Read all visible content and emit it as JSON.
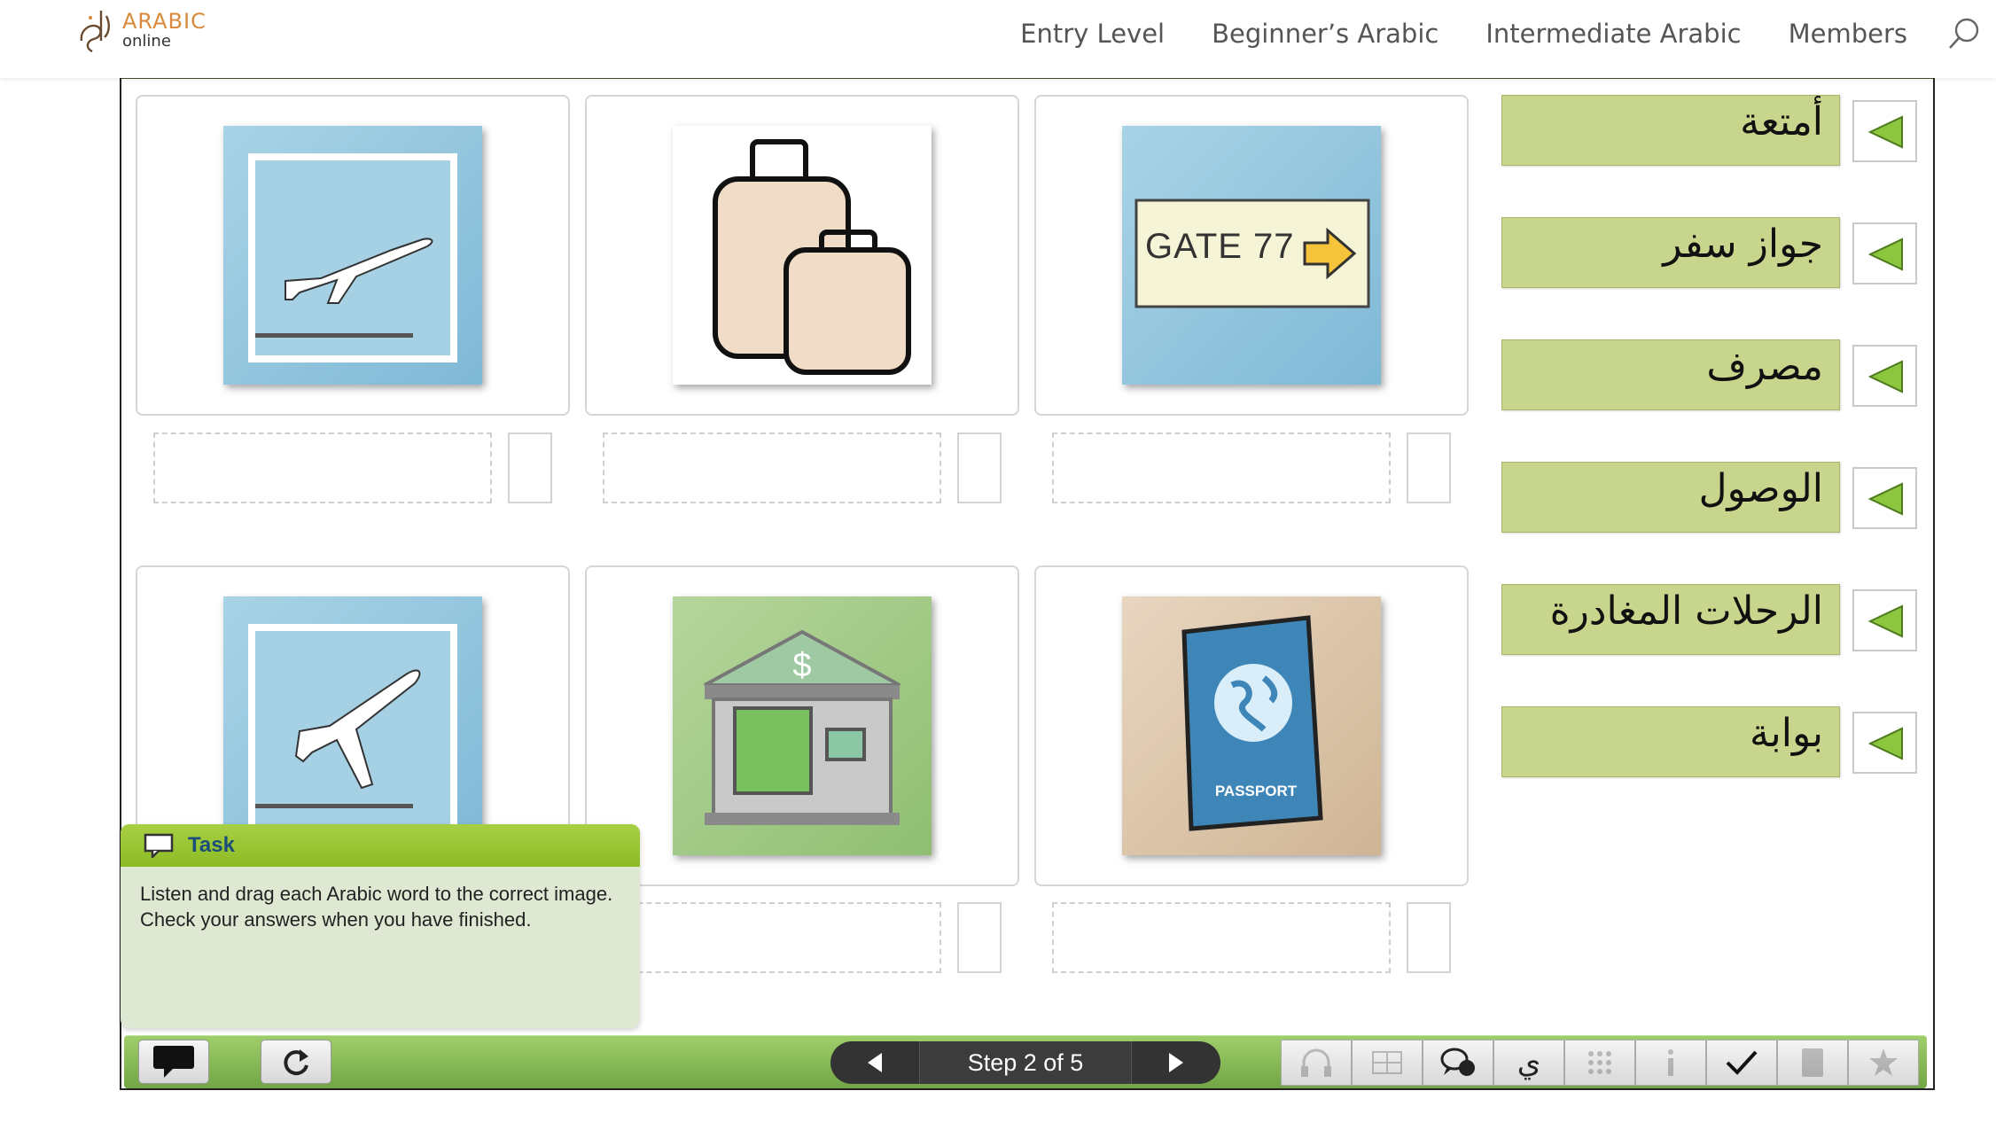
{
  "site": {
    "logo_text": "ARABIC",
    "logo_sub": "online"
  },
  "nav": {
    "items": [
      "Entry Level",
      "Beginner’s Arabic",
      "Intermediate Arabic",
      "Members"
    ],
    "search_icon": "search-icon"
  },
  "cards": [
    {
      "image": "airplane-departure",
      "gate_text": ""
    },
    {
      "image": "luggage",
      "gate_text": ""
    },
    {
      "image": "gate-sign",
      "gate_text": "GATE 77"
    },
    {
      "image": "airplane-arrival",
      "gate_text": ""
    },
    {
      "image": "bank-exchange",
      "gate_text": ""
    },
    {
      "image": "passport",
      "gate_text": "PASSPORT"
    }
  ],
  "words": [
    "أمتعة",
    "جواز سفر",
    "مصرف",
    "الوصول",
    "الرحلات المغادرة",
    "بوابة"
  ],
  "task": {
    "title": "Task",
    "text": "Listen and drag each Arabic word to the correct image. Check your answers when you have finished."
  },
  "stepper": {
    "label": "Step 2 of 5"
  },
  "toolbar": {
    "arabic_glyph": "ي",
    "tools": [
      "headphones-icon",
      "translate-icon",
      "speech-icon",
      "arabic-keyboard-icon",
      "grid-icon",
      "info-icon",
      "check-icon",
      "calculator-icon",
      "star-icon"
    ]
  },
  "colors": {
    "word_tile": "#c8d58d",
    "play_triangle": "#8cc63f",
    "bottom_bar": "#8dbb54",
    "task_header": "#9bc93a",
    "title_blue": "#1c4e7a"
  }
}
